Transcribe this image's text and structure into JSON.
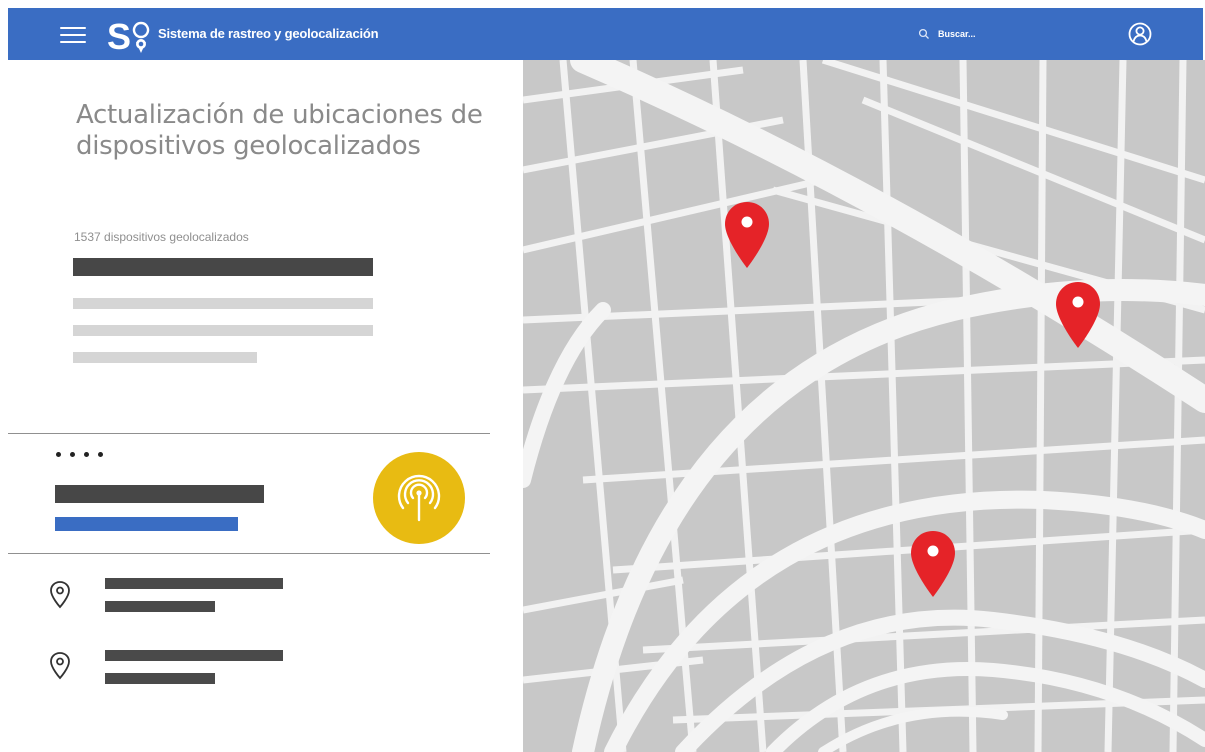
{
  "header": {
    "logo_text": "S",
    "app_title": "Sistema de rastreo y geolocalización",
    "search_placeholder": "Buscar..."
  },
  "colors": {
    "brand_blue": "#3a6dc3",
    "accent_yellow": "#e8bb12",
    "marker_red": "#e52328",
    "map_block_gray": "#c8c8c8",
    "map_road_white": "#f4f4f4"
  },
  "icons": {
    "menu": "hamburger-icon",
    "search": "search-icon",
    "user": "user-icon",
    "signal": "broadcast-icon",
    "location": "location-pin-icon",
    "marker": "map-marker-icon"
  },
  "main": {
    "title": "Actualización de ubicaciones de dispositivos geolocalizados",
    "device_count_label": "1537 dispositivos geolocalizados"
  },
  "map": {
    "markers": [
      {
        "name": "map-marker-1"
      },
      {
        "name": "map-marker-2"
      },
      {
        "name": "map-marker-3"
      }
    ]
  }
}
